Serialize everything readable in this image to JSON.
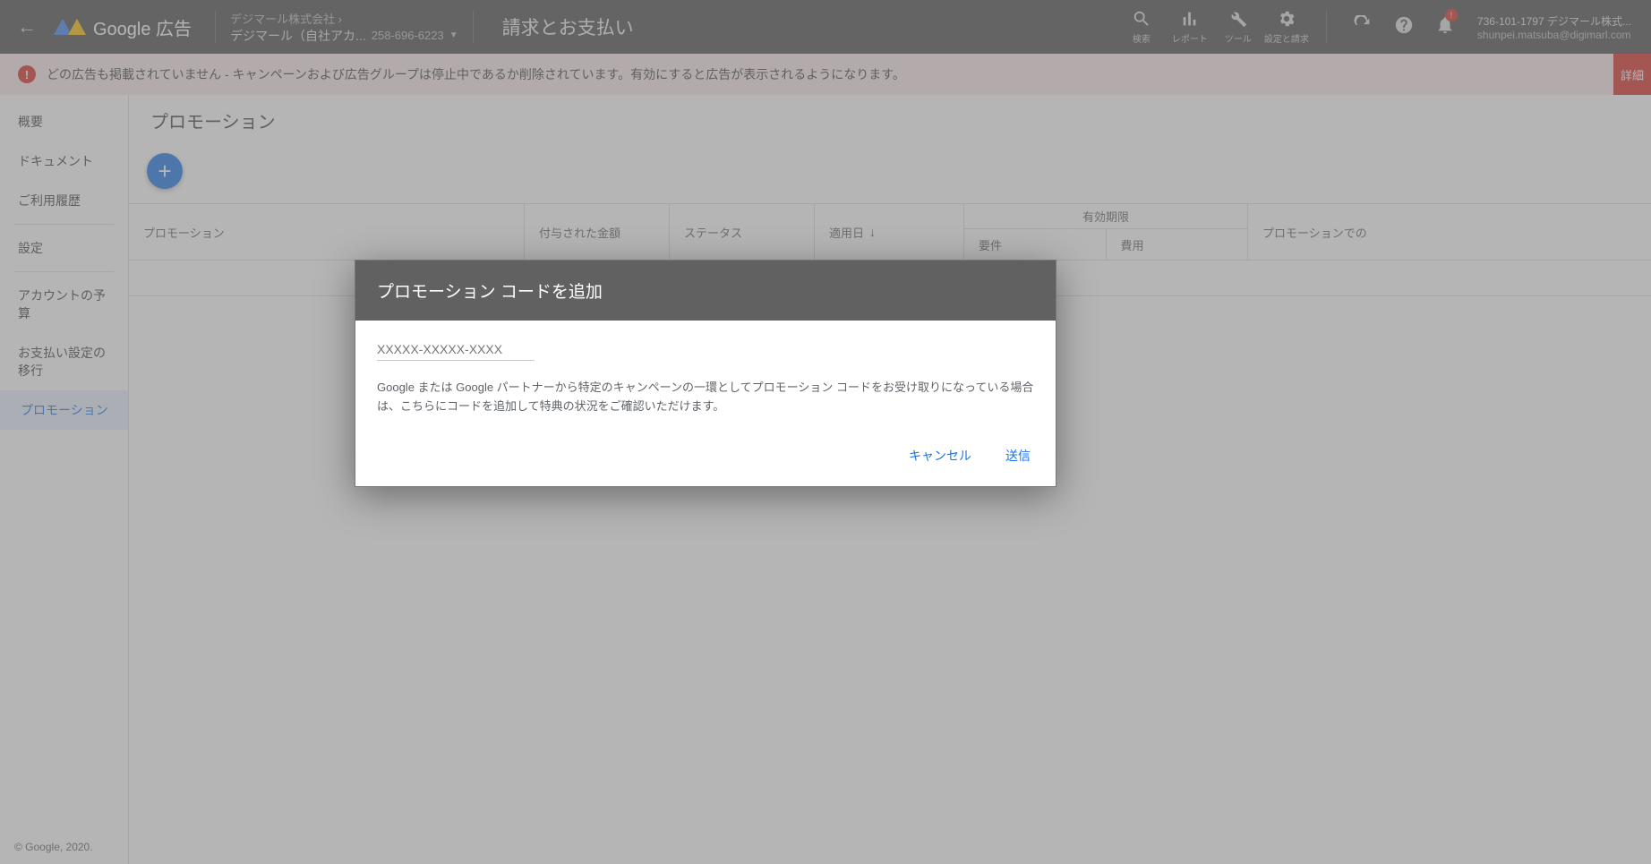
{
  "header": {
    "logo_text": "Google 広告",
    "account_parent": "デジマール株式会社 ›",
    "account_name": "デジマール（自社アカ...",
    "account_id": "258-696-6223",
    "page_title": "請求とお支払い",
    "icons": {
      "search": "検索",
      "reports": "レポート",
      "tools": "ツール",
      "settings": "設定と請求"
    },
    "user": {
      "line1": "736-101-1797 デジマール株式...",
      "line2": "shunpei.matsuba@digimarl.com"
    },
    "notif_badge": "!"
  },
  "warning": {
    "text": "どの広告も掲載されていません - キャンペーンおよび広告グループは停止中であるか削除されています。有効にすると広告が表示されるようになります。",
    "detail_btn": "詳細"
  },
  "sidebar": {
    "items": [
      "概要",
      "ドキュメント",
      "ご利用履歴",
      "設定",
      "アカウントの予算",
      "お支払い設定の移行",
      "プロモーション"
    ],
    "footer": "© Google, 2020."
  },
  "content": {
    "title": "プロモーション",
    "columns": {
      "promotion": "プロモーション",
      "amount": "付与された金額",
      "status": "ステータス",
      "applied": "適用日",
      "validity": "有効期限",
      "req": "要件",
      "cost": "費用",
      "promo_in": "プロモーションでの"
    }
  },
  "modal": {
    "title": "プロモーション コードを追加",
    "placeholder": "XXXXX-XXXXX-XXXX",
    "desc": "Google または Google パートナーから特定のキャンペーンの一環としてプロモーション コードをお受け取りになっている場合は、こちらにコードを追加して特典の状況をご確認いただけます。",
    "cancel": "キャンセル",
    "submit": "送信"
  }
}
